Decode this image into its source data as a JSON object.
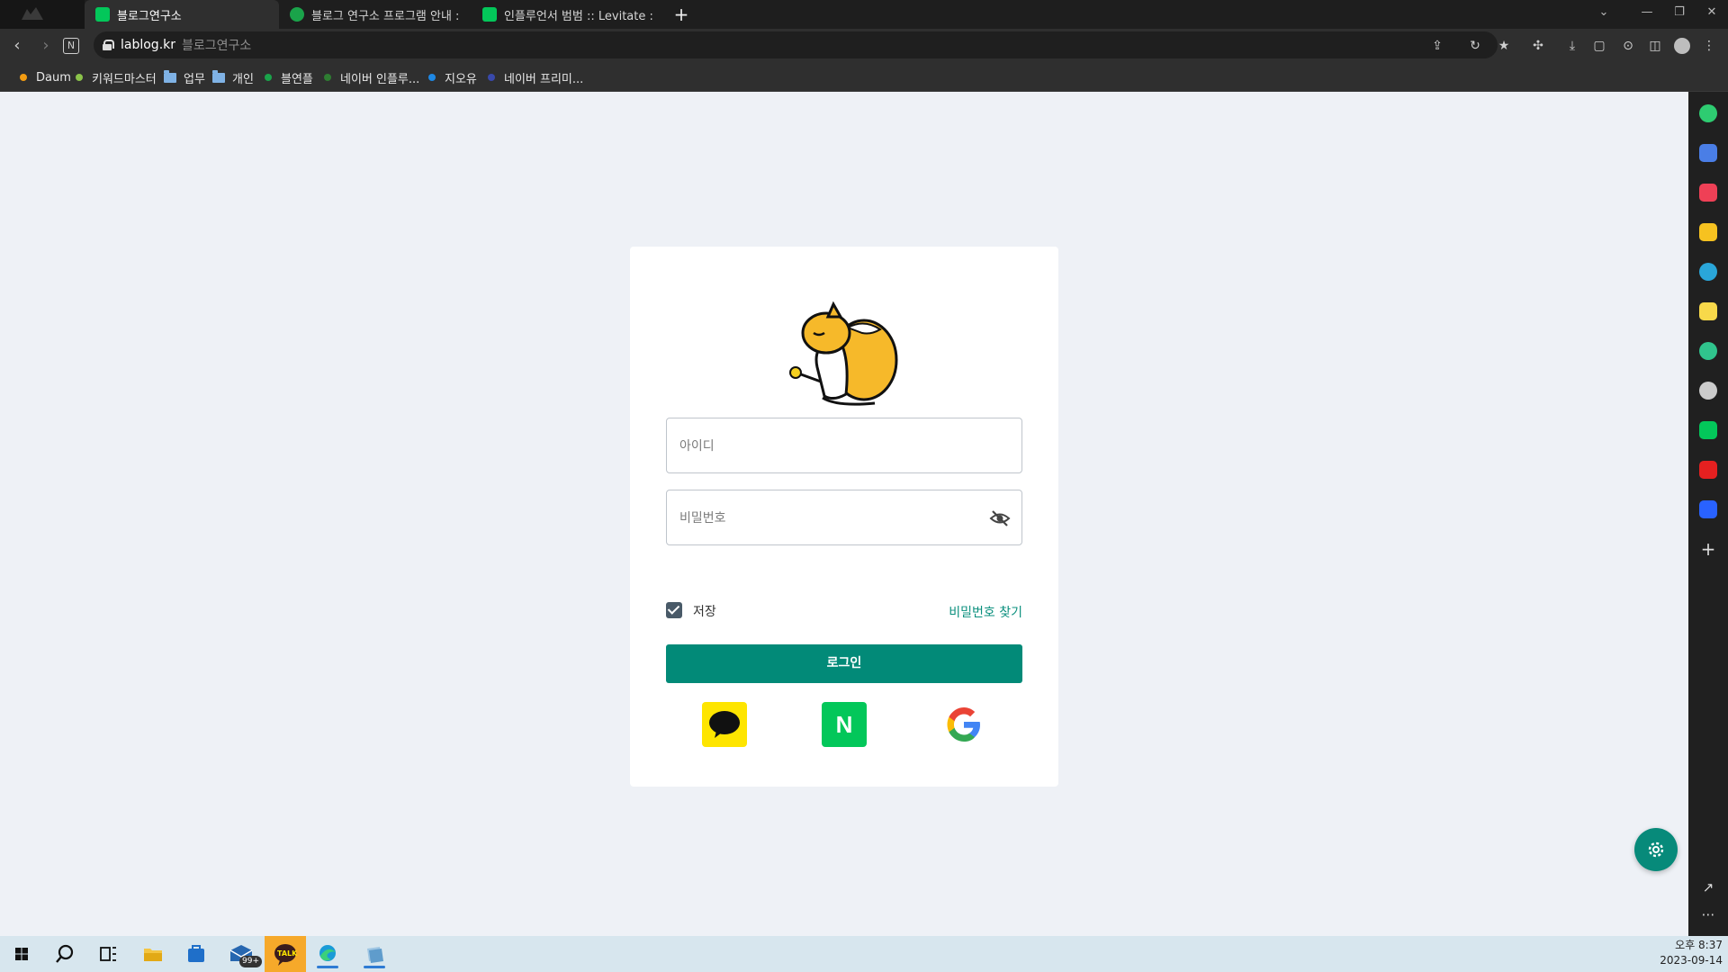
{
  "browser": {
    "tabs": [
      {
        "label": "블로그연구소",
        "favicon_color": "#03c75a",
        "active": true
      },
      {
        "label": "블로그 연구소 프로그램 안내 : ",
        "favicon_color": "#1aa34a",
        "active": false
      },
      {
        "label": "인플루언서 범범 :: Levitate : 네이",
        "favicon_color": "#03c75a",
        "active": false
      }
    ],
    "new_tab_label": "+",
    "url_host": "lablog.kr",
    "url_title": "블로그연구소",
    "bookmarks": [
      {
        "label": "Daum",
        "type": "dot",
        "color": "#f39c12"
      },
      {
        "label": "키워드마스터",
        "type": "dot",
        "color": "#8bc34a"
      },
      {
        "label": "업무",
        "type": "folder"
      },
      {
        "label": "개인",
        "type": "folder"
      },
      {
        "label": "블연플",
        "type": "dot",
        "color": "#1aa34a"
      },
      {
        "label": "네이버 인플루...",
        "type": "dot",
        "color": "#2e7d32"
      },
      {
        "label": "지오유",
        "type": "dot",
        "color": "#1e88e5"
      },
      {
        "label": "네이버 프리미...",
        "type": "dot",
        "color": "#1a237e"
      }
    ],
    "side_panel_icons": [
      {
        "name": "copilot-icon",
        "color": "#2ecc71"
      },
      {
        "name": "briefcase-icon",
        "color": "#4a7ee6"
      },
      {
        "name": "pocket-icon",
        "color": "#ef4056"
      },
      {
        "name": "favorites-icon",
        "color": "#f6c220"
      },
      {
        "name": "edge-icon",
        "color": "#2aa6d9"
      },
      {
        "name": "notes-icon",
        "color": "#f8d94a"
      },
      {
        "name": "play-icon",
        "color": "#30c48d"
      },
      {
        "name": "openai-icon",
        "color": "#cccccc"
      },
      {
        "name": "blog-icon",
        "color": "#03c75a"
      },
      {
        "name": "wow-icon",
        "color": "#e52020"
      },
      {
        "name": "s-app-icon",
        "color": "#2962ff"
      }
    ]
  },
  "login": {
    "id_placeholder": "아이디",
    "password_placeholder": "비밀번호",
    "remember_label": "저장",
    "remember_checked": true,
    "find_password_label": "비밀번호 찾기",
    "login_button_label": "로그인",
    "accent_color": "#028a78",
    "social": [
      {
        "name": "kakao",
        "color": "#fee500"
      },
      {
        "name": "naver",
        "label": "N",
        "color": "#03c75a"
      },
      {
        "name": "google",
        "color": "#ffffff"
      }
    ]
  },
  "taskbar": {
    "mail_badge": "99+",
    "kakao_label": "TALK",
    "time": "오후 8:37",
    "date": "2023-09-14"
  }
}
